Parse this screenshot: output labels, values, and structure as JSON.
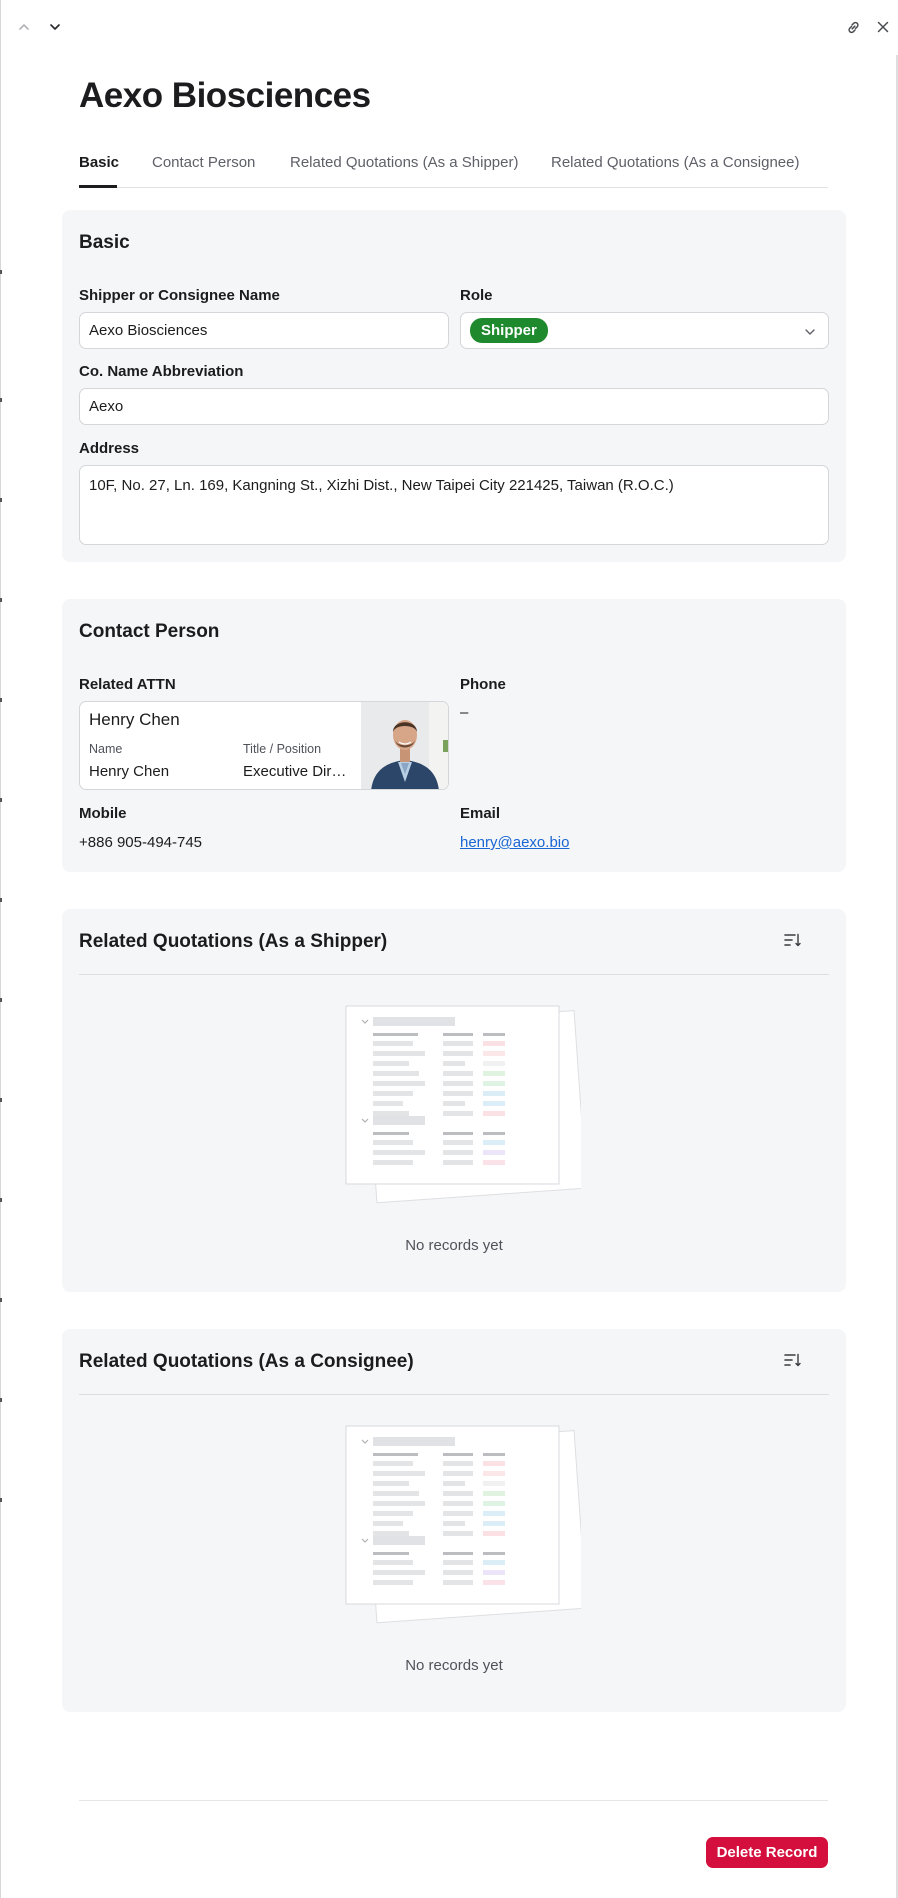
{
  "record": {
    "title": "Aexo Biosciences"
  },
  "tabs": [
    {
      "label": "Basic",
      "active": true
    },
    {
      "label": "Contact Person",
      "active": false
    },
    {
      "label": "Related Quotations (As a Shipper)",
      "active": false
    },
    {
      "label": "Related Quotations (As a Consignee)",
      "active": false
    }
  ],
  "basic": {
    "title": "Basic",
    "name_label": "Shipper or Consignee Name",
    "name_value": "Aexo Biosciences",
    "role_label": "Role",
    "role_value": "Shipper",
    "role_color": "#1f8a2d",
    "abbr_label": "Co. Name Abbreviation",
    "abbr_value": "Aexo",
    "address_label": "Address",
    "address_value": "10F, No. 27, Ln. 169, Kangning St., Xizhi Dist., New Taipei City 221425, Taiwan (R.O.C.)"
  },
  "contact": {
    "title": "Contact Person",
    "attn_label": "Related ATTN",
    "card": {
      "heading": "Henry Chen",
      "name_label": "Name",
      "name_value": "Henry Chen",
      "position_label": "Title / Position",
      "position_value": "Executive Dir…"
    },
    "phone_label": "Phone",
    "phone_value": "–",
    "mobile_label": "Mobile",
    "mobile_value": "+886 905-494-745",
    "email_label": "Email",
    "email_value": "henry@aexo.bio"
  },
  "shipper_quotes": {
    "title": "Related Quotations (As a Shipper)",
    "empty_text": "No records yet"
  },
  "consignee_quotes": {
    "title": "Related Quotations (As a Consignee)",
    "empty_text": "No records yet"
  },
  "footer": {
    "delete_label": "Delete Record",
    "delete_color": "#d40f3d"
  },
  "icons": {
    "prev": "chevron-up-icon",
    "next": "chevron-down-icon",
    "link": "link-icon",
    "close": "close-icon",
    "sort": "sort-icon",
    "role_dropdown": "chevron-down-icon"
  }
}
